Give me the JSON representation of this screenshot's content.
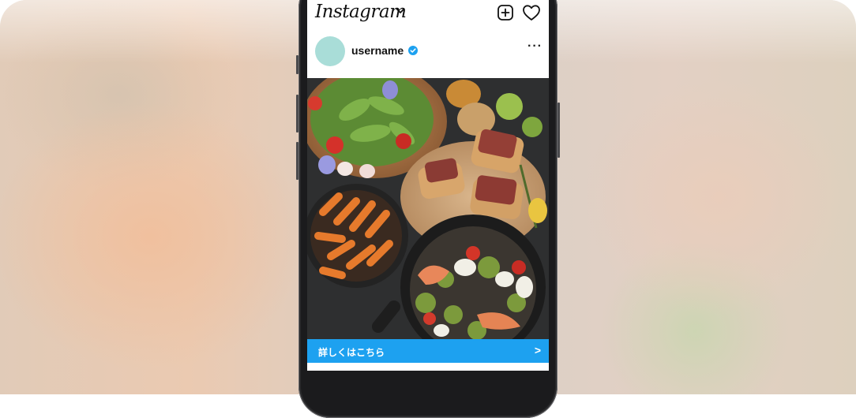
{
  "app": {
    "name": "Instagram"
  },
  "post": {
    "username": "username",
    "cta_label": "詳しくはこちら",
    "cta_arrow": ">",
    "more_label": "···",
    "liked": true
  },
  "icons": [
    "chevron-down-icon",
    "new-post-icon",
    "heart-icon",
    "verified-badge-icon",
    "more-icon",
    "like-icon",
    "comment-icon",
    "share-icon",
    "bookmark-icon"
  ],
  "colors": {
    "cta": "#1da1f0",
    "like": "#ed1c3c",
    "verified": "#1da1f0",
    "avatar": "#a9ddd8"
  }
}
